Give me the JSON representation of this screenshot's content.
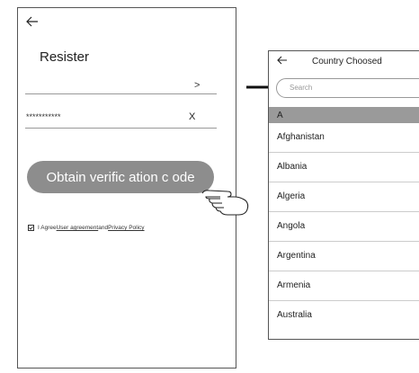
{
  "register_screen": {
    "back_icon": "arrow-left-icon",
    "title": "Resister",
    "field1_arrow": ">",
    "password_mask": "***********",
    "password_clear": "X",
    "obtain_button": "Obtain  verific  ation c  ode",
    "agree_text": "I Agree ",
    "user_agreement_link": "User agreement",
    "and_text": " and ",
    "privacy_link": "Privacy Policy",
    "checkbox_mark": "☑"
  },
  "country_screen": {
    "back_icon": "arrow-left-icon",
    "title": "Country Choosed",
    "search_placeholder": "Search",
    "section_letter": "A",
    "countries": [
      "Afghanistan",
      "Albania",
      "Algeria",
      "Angola",
      "Argentina",
      "Armenia",
      "Australia"
    ]
  }
}
